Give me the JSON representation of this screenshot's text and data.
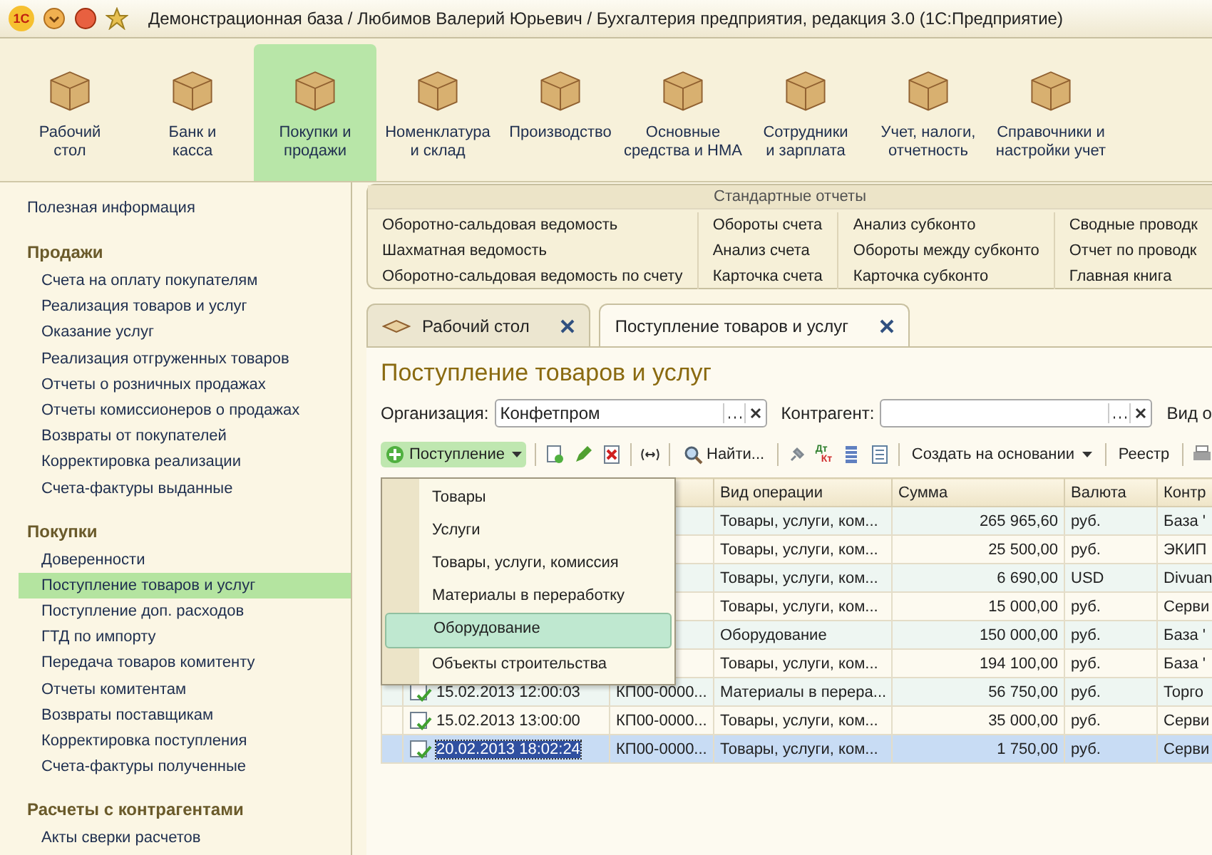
{
  "window": {
    "title": "Демонстрационная база / Любимов Валерий Юрьевич / Бухгалтерия предприятия, редакция 3.0  (1С:Предприятие)",
    "logo": "1С"
  },
  "sections": [
    {
      "label": "Рабочий\nстол",
      "selected": false
    },
    {
      "label": "Банк и\nкасса",
      "selected": false
    },
    {
      "label": "Покупки и\nпродажи",
      "selected": true
    },
    {
      "label": "Номенклатура\nи склад",
      "selected": false
    },
    {
      "label": "Производство",
      "selected": false
    },
    {
      "label": "Основные\nсредства и НМА",
      "selected": false
    },
    {
      "label": "Сотрудники\nи зарплата",
      "selected": false
    },
    {
      "label": "Учет, налоги,\nотчетность",
      "selected": false
    },
    {
      "label": "Справочники и\nнастройки учет",
      "selected": false
    }
  ],
  "sidebar": {
    "top": "Полезная информация",
    "groups": [
      {
        "title": "Продажи",
        "items": [
          {
            "label": "Счета на оплату покупателям",
            "selected": false
          },
          {
            "label": "Реализация товаров и услуг",
            "selected": false
          },
          {
            "label": "Оказание услуг",
            "selected": false
          },
          {
            "label": "Реализация отгруженных товаров",
            "selected": false
          },
          {
            "label": "Отчеты о розничных продажах",
            "selected": false
          },
          {
            "label": "Отчеты комиссионеров о продажах",
            "selected": false
          },
          {
            "label": "Возвраты от покупателей",
            "selected": false
          },
          {
            "label": "Корректировка реализации",
            "selected": false
          },
          {
            "label": "Счета-фактуры выданные",
            "selected": false
          }
        ]
      },
      {
        "title": "Покупки",
        "items": [
          {
            "label": "Доверенности",
            "selected": false
          },
          {
            "label": "Поступление товаров и услуг",
            "selected": true
          },
          {
            "label": "Поступление доп. расходов",
            "selected": false
          },
          {
            "label": "ГТД по импорту",
            "selected": false
          },
          {
            "label": "Передача товаров комитенту",
            "selected": false
          },
          {
            "label": "Отчеты комитентам",
            "selected": false
          },
          {
            "label": "Возвраты поставщикам",
            "selected": false
          },
          {
            "label": "Корректировка поступления",
            "selected": false
          },
          {
            "label": "Счета-фактуры полученные",
            "selected": false
          }
        ]
      },
      {
        "title": "Расчеты с контрагентами",
        "items": [
          {
            "label": "Акты сверки расчетов",
            "selected": false
          }
        ]
      }
    ]
  },
  "reports": {
    "title": "Стандартные отчеты",
    "columns": [
      [
        "Оборотно-сальдовая ведомость",
        "Шахматная ведомость",
        "Оборотно-сальдовая ведомость по счету"
      ],
      [
        "Обороты счета",
        "Анализ счета",
        "Карточка счета"
      ],
      [
        "Анализ субконто",
        "Обороты между субконто",
        "Карточка субконто"
      ],
      [
        "Сводные проводк",
        "Отчет по проводк",
        "Главная книга"
      ]
    ]
  },
  "tabs": [
    {
      "label": "Рабочий стол",
      "selected": false
    },
    {
      "label": "Поступление товаров и услуг",
      "selected": true
    }
  ],
  "form": {
    "title": "Поступление товаров и услуг",
    "filters": [
      {
        "label": "Организация:",
        "value": "Конфетпром"
      },
      {
        "label": "Контрагент:"
      }
    ],
    "filter_cut": "Вид о",
    "toolbar": {
      "create": "Поступление",
      "find": "Найти...",
      "dt": "Дт",
      "kt": "Кт",
      "based_on": "Создать на основании",
      "registry": "Реестр"
    },
    "menu": [
      {
        "label": "Товары",
        "selected": false
      },
      {
        "label": "Услуги",
        "selected": false
      },
      {
        "label": "Товары, услуги, комиссия",
        "selected": false
      },
      {
        "label": "Материалы в переработку",
        "selected": false
      },
      {
        "label": "Оборудование",
        "selected": true
      },
      {
        "label": "Объекты строительства",
        "selected": false
      }
    ],
    "columns": [
      "Вид операции",
      "Сумма",
      "Валюта",
      "Контр"
    ],
    "rows": [
      {
        "operation": "Товары, услуги, ком...",
        "sum": "265 965,60",
        "currency": "руб.",
        "party": "База '",
        "selected": false
      },
      {
        "operation": "Товары, услуги, ком...",
        "sum": "25 500,00",
        "currency": "руб.",
        "party": "ЭКИП",
        "selected": false
      },
      {
        "operation": "Товары, услуги, ком...",
        "sum": "6 690,00",
        "currency": "USD",
        "party": "Divuan",
        "selected": false
      },
      {
        "operation": "Товары, услуги, ком...",
        "sum": "15 000,00",
        "currency": "руб.",
        "party": "Серви",
        "selected": false
      },
      {
        "operation": "Оборудование",
        "sum": "150 000,00",
        "currency": "руб.",
        "party": "База '",
        "selected": false
      },
      {
        "operation": "Товары, услуги, ком...",
        "sum": "194 100,00",
        "currency": "руб.",
        "party": "База '",
        "selected": false
      },
      {
        "date": "15.02.2013 12:00:03",
        "number": "КП00-0000...",
        "operation": "Материалы в перера...",
        "sum": "56 750,00",
        "currency": "руб.",
        "party": "Торго",
        "selected": false
      },
      {
        "date": "15.02.2013 13:00:00",
        "number": "КП00-0000...",
        "operation": "Товары, услуги, ком...",
        "sum": "35 000,00",
        "currency": "руб.",
        "party": "Серви",
        "selected": false
      },
      {
        "date": "20.02.2013 18:02:24",
        "number": "КП00-0000...",
        "operation": "Товары, услуги, ком...",
        "sum": "1 750,00",
        "currency": "руб.",
        "party": "Серви",
        "selected": true
      }
    ]
  }
}
